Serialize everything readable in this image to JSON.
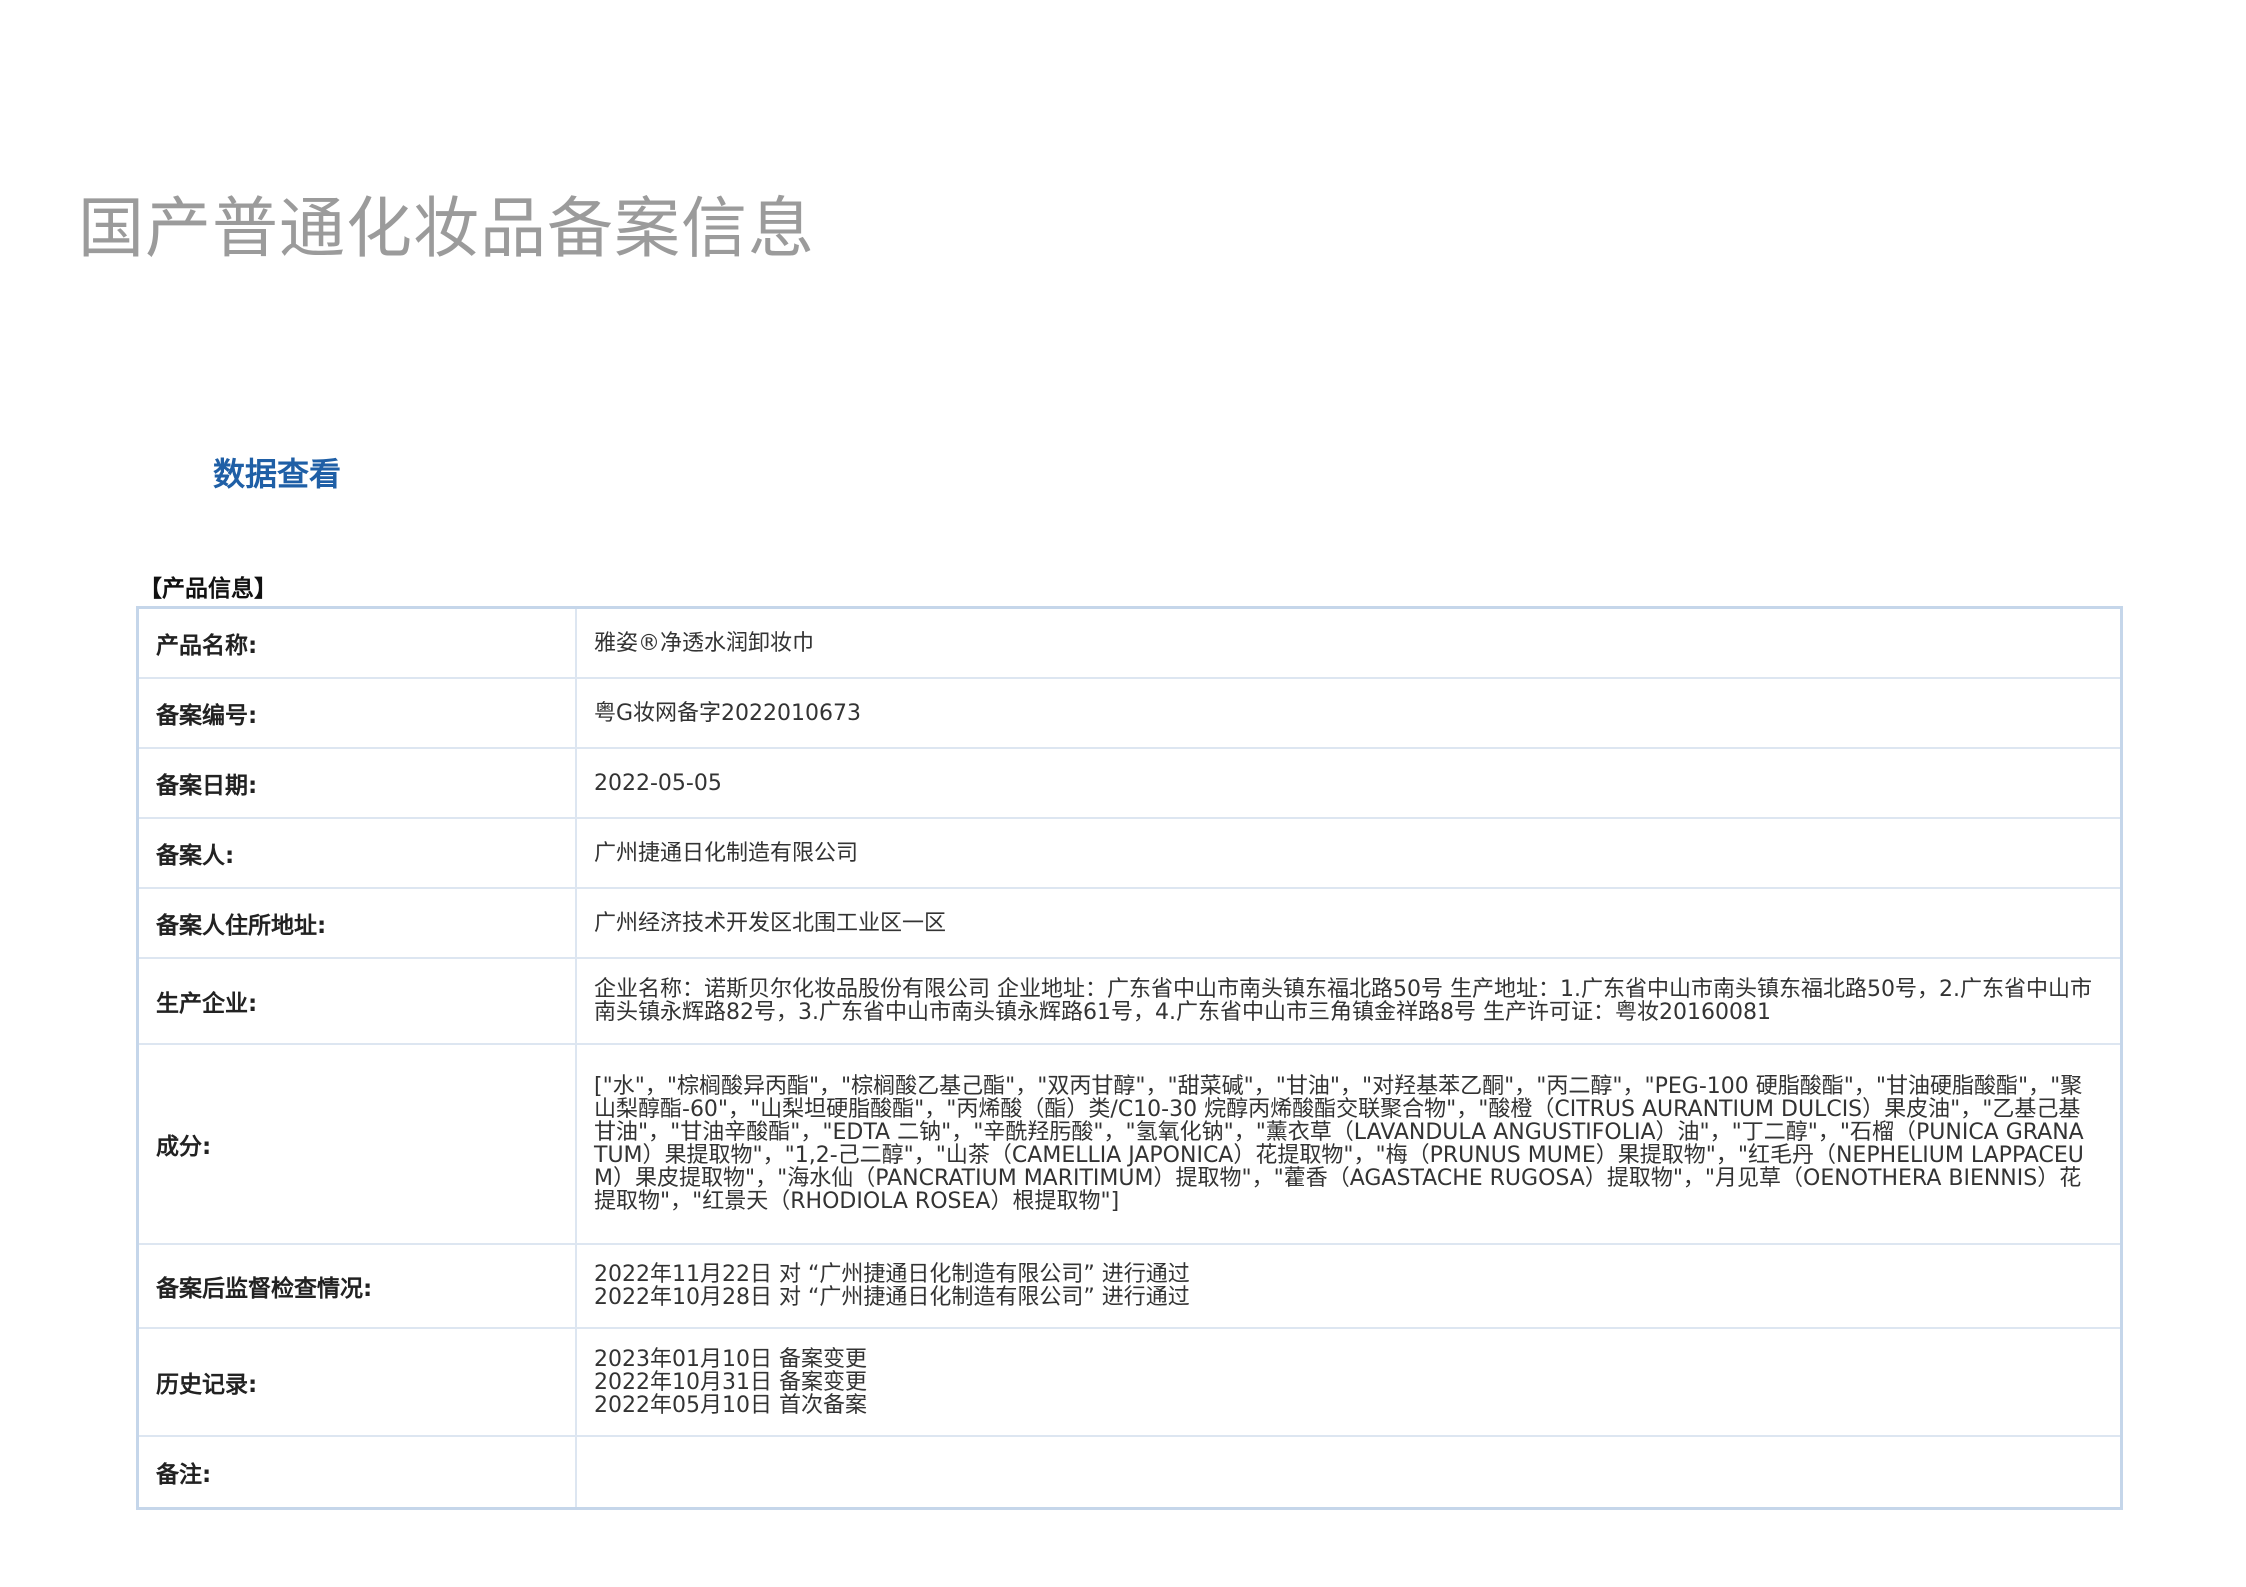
{
  "page": {
    "title": "国产普通化妆品备案信息",
    "section_title": "数据查看",
    "group_title": "【产品信息】"
  },
  "rows": [
    {
      "label": "产品名称:",
      "value": "雅姿®净透水润卸妆巾"
    },
    {
      "label": "备案编号:",
      "value": "粤G妆网备字2022010673"
    },
    {
      "label": "备案日期:",
      "value": "2022-05-05"
    },
    {
      "label": "备案人:",
      "value": "广州捷通日化制造有限公司"
    },
    {
      "label": "备案人住所地址:",
      "value": "广州经济技术开发区北围工业区一区"
    },
    {
      "label": "生产企业:",
      "value": "企业名称：诺斯贝尔化妆品股份有限公司 企业地址：广东省中山市南头镇东福北路50号 生产地址：1.广东省中山市南头镇东福北路50号，2.广东省中山市南头镇永辉路82号，3.广东省中山市南头镇永辉路61号，4.广东省中山市三角镇金祥路8号 生产许可证：粤妆20160081"
    },
    {
      "label": "成分:",
      "value": "[\"水\"，\"棕榈酸异丙酯\"，\"棕榈酸乙基己酯\"，\"双丙甘醇\"，\"甜菜碱\"，\"甘油\"，\"对羟基苯乙酮\"，\"丙二醇\"，\"PEG-100 硬脂酸酯\"，\"甘油硬脂酸酯\"，\"聚山梨醇酯-60\"，\"山梨坦硬脂酸酯\"，\"丙烯酸（酯）类/C10-30 烷醇丙烯酸酯交联聚合物\"，\"酸橙（CITRUS AURANTIUM DULCIS）果皮油\"，\"乙基己基甘油\"，\"甘油辛酸酯\"，\"EDTA 二钠\"，\"辛酰羟肟酸\"，\"氢氧化钠\"，\"薰衣草（LAVANDULA ANGUSTIFOLIA）油\"，\"丁二醇\"，\"石榴（PUNICA GRANATUM）果提取物\"，\"1,2-己二醇\"，\"山茶（CAMELLIA JAPONICA）花提取物\"，\"梅（PRUNUS MUME）果提取物\"，\"红毛丹（NEPHELIUM LAPPACEUM）果皮提取物\"，\"海水仙（PANCRATIUM MARITIMUM）提取物\"，\"藿香（AGASTACHE RUGOSA）提取物\"，\"月见草（OENOTHERA BIENNIS）花提取物\"，\"红景天（RHODIOLA ROSEA）根提取物\"]"
    },
    {
      "label": "备案后监督检查情况:",
      "lines": [
        "2022年11月22日 对 “广州捷通日化制造有限公司” 进行通过",
        "2022年10月28日 对 “广州捷通日化制造有限公司” 进行通过"
      ]
    },
    {
      "label": "历史记录:",
      "lines": [
        "2023年01月10日 备案变更",
        "2022年10月31日 备案变更",
        "2022年05月10日 首次备案"
      ]
    },
    {
      "label": "备注:",
      "value": ""
    }
  ]
}
